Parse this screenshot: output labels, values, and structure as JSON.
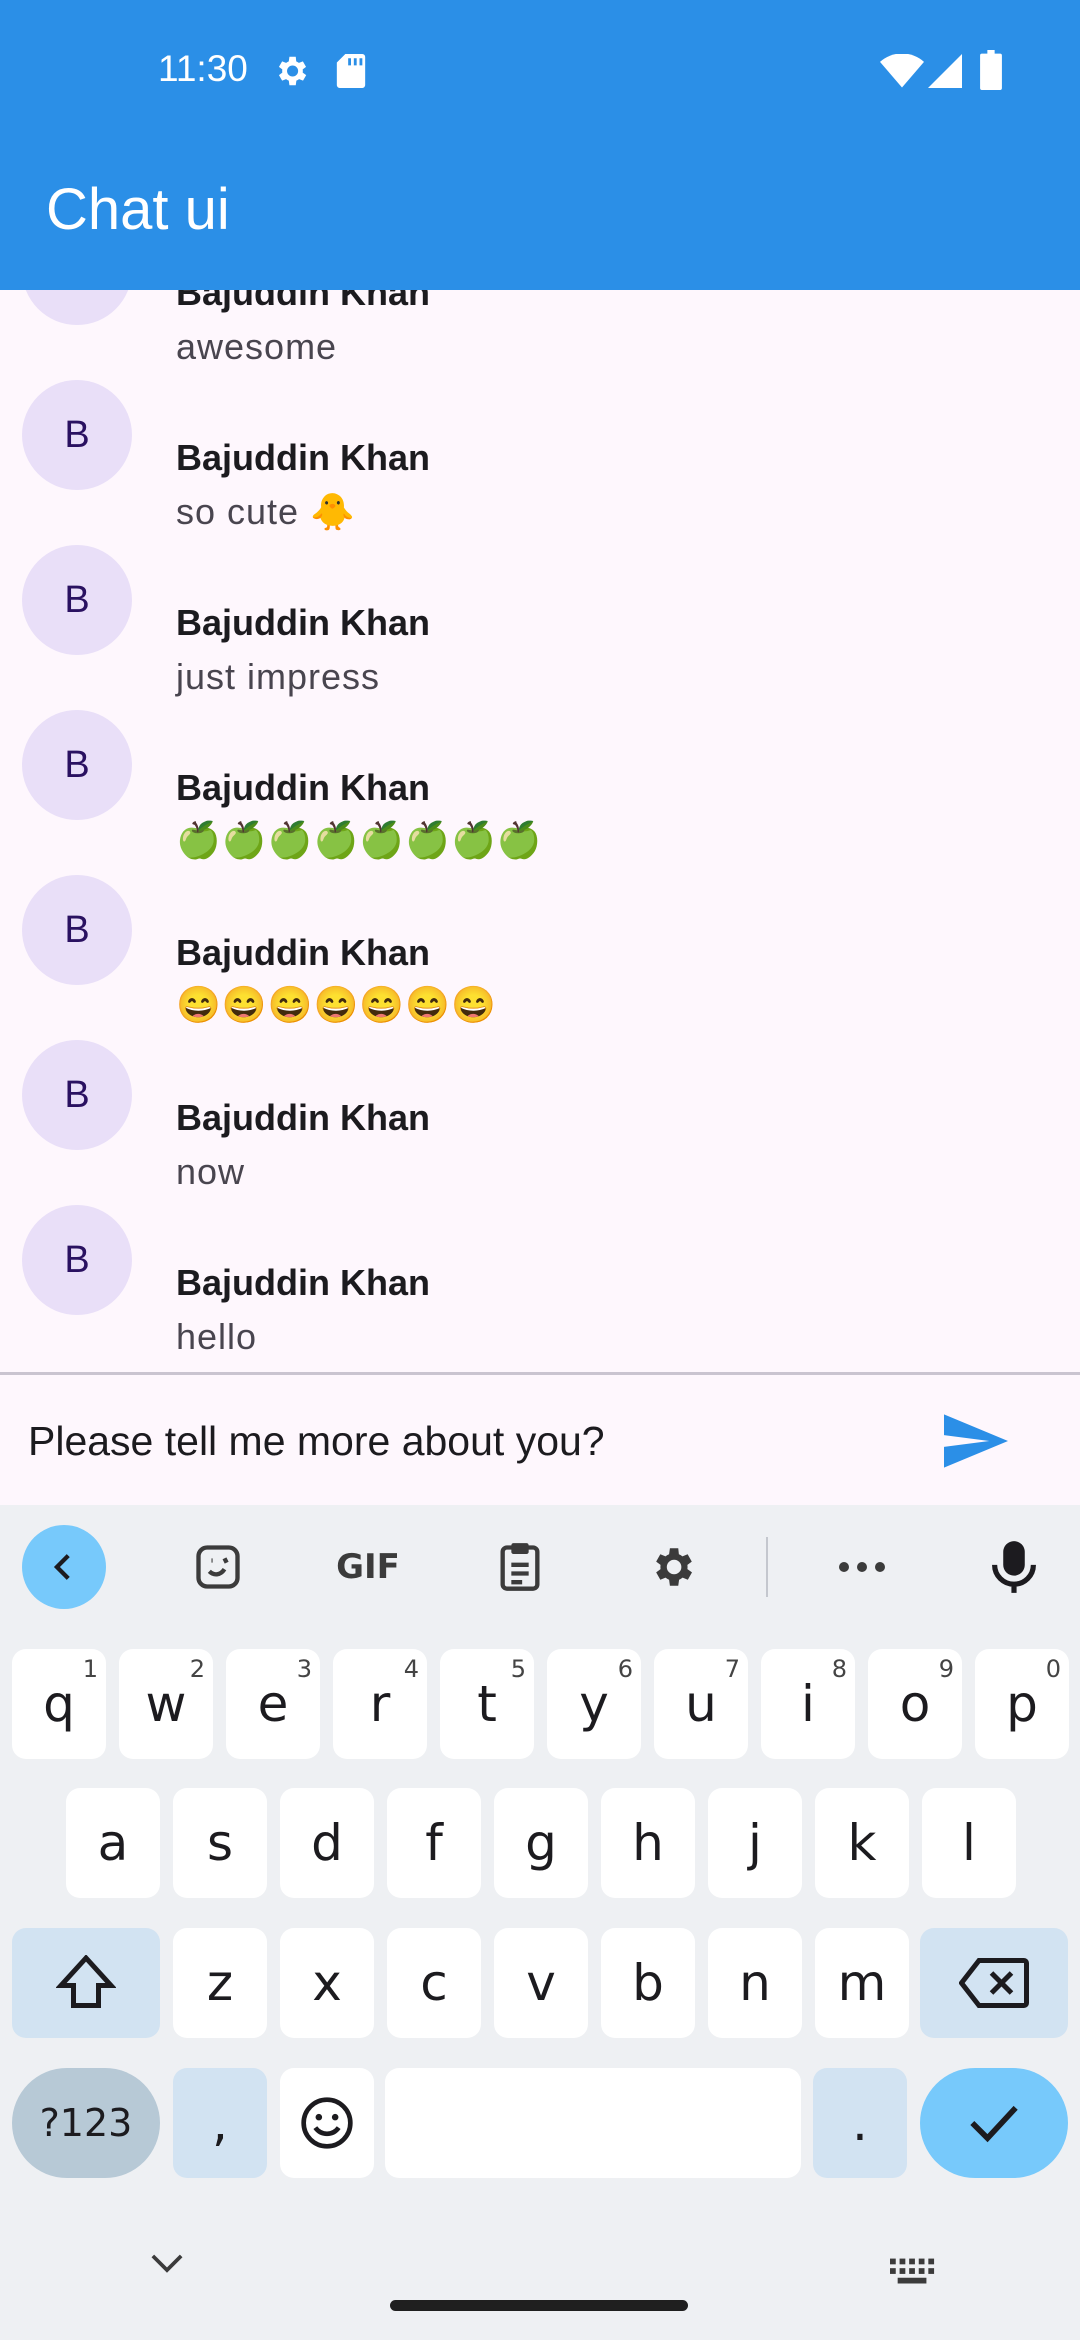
{
  "status_bar": {
    "time": "11:30",
    "left_icons": [
      "settings-icon",
      "sd-card-icon"
    ],
    "right_icons": [
      "wifi-icon",
      "signal-icon",
      "battery-icon"
    ]
  },
  "app_bar": {
    "title": "Chat ui",
    "color": "#2b8fe7"
  },
  "chat": {
    "messages": [
      {
        "avatar": "B",
        "sender": "Bajuddin Khan",
        "text": "awesome"
      },
      {
        "avatar": "B",
        "sender": "Bajuddin Khan",
        "text": "so cute 🐥"
      },
      {
        "avatar": "B",
        "sender": "Bajuddin Khan",
        "text": "just impress"
      },
      {
        "avatar": "B",
        "sender": "Bajuddin Khan",
        "text": "🍏🍏🍏🍏🍏🍏🍏🍏"
      },
      {
        "avatar": "B",
        "sender": "Bajuddin Khan",
        "text": "😄😄😄😄😄😄😄"
      },
      {
        "avatar": "B",
        "sender": "Bajuddin Khan",
        "text": "now"
      },
      {
        "avatar": "B",
        "sender": "Bajuddin Khan",
        "text": "hello"
      }
    ]
  },
  "composer": {
    "value": "Please tell me more about you?",
    "send_icon": "send-icon"
  },
  "keyboard": {
    "toolbar": [
      "collapse-icon",
      "sticker-icon",
      "gif-icon",
      "clipboard-icon",
      "settings-icon",
      "more-icon",
      "mic-icon"
    ],
    "gif_label": "GIF",
    "row1": [
      {
        "key": "q",
        "hint": "1"
      },
      {
        "key": "w",
        "hint": "2"
      },
      {
        "key": "e",
        "hint": "3"
      },
      {
        "key": "r",
        "hint": "4"
      },
      {
        "key": "t",
        "hint": "5"
      },
      {
        "key": "y",
        "hint": "6"
      },
      {
        "key": "u",
        "hint": "7"
      },
      {
        "key": "i",
        "hint": "8"
      },
      {
        "key": "o",
        "hint": "9"
      },
      {
        "key": "p",
        "hint": "0"
      }
    ],
    "row2": [
      "a",
      "s",
      "d",
      "f",
      "g",
      "h",
      "j",
      "k",
      "l"
    ],
    "row3": [
      "z",
      "x",
      "c",
      "v",
      "b",
      "n",
      "m"
    ],
    "symbols_key": "?123",
    "comma_key": ",",
    "period_key": "."
  }
}
